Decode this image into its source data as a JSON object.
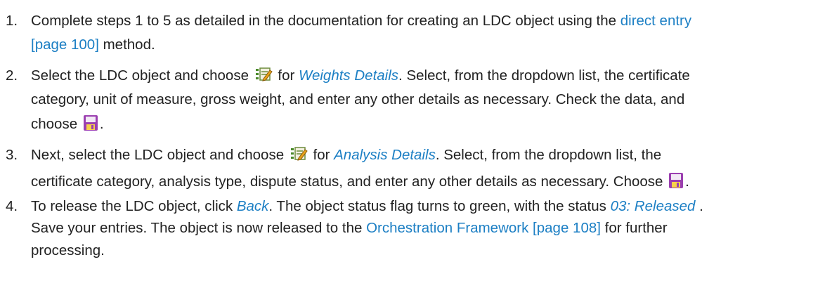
{
  "steps": [
    {
      "number": "1.",
      "part1": "Complete steps 1 to 5 as detailed in the documentation for creating an LDC object using the ",
      "link": "direct entry",
      "link2": "[page 100]",
      "part2": " method."
    },
    {
      "number": "2.",
      "part1": "Select the LDC object and choose ",
      "part2": " for ",
      "emph": "Weights Details",
      "part3": ". Select, from the dropdown list, the certificate",
      "line2": "category, unit of measure, gross weight, and enter any other details as necessary. Check the data, and",
      "line3": "choose ",
      "line3_end": "."
    },
    {
      "number": "3.",
      "part1": "Next, select the LDC object and choose ",
      "part2": " for ",
      "emph": "Analysis Details",
      "part3": ". Select, from the dropdown list, the",
      "line2": "certificate category, analysis type, dispute status, and enter any other details as necessary. Choose ",
      "line2_end": "."
    },
    {
      "number": "4.",
      "part1": "To release the LDC object, click ",
      "emph1": "Back",
      "part2": ". The object status flag turns to green, with the status ",
      "emph2": "03: Released",
      "part3": " .",
      "line2": "Save your entries. The object is now released to the ",
      "link": "Orchestration Framework [page 108]",
      "line2_end": " for further",
      "line3": "processing."
    }
  ],
  "icons": {
    "details": "edit-details-icon",
    "save": "save-icon"
  }
}
